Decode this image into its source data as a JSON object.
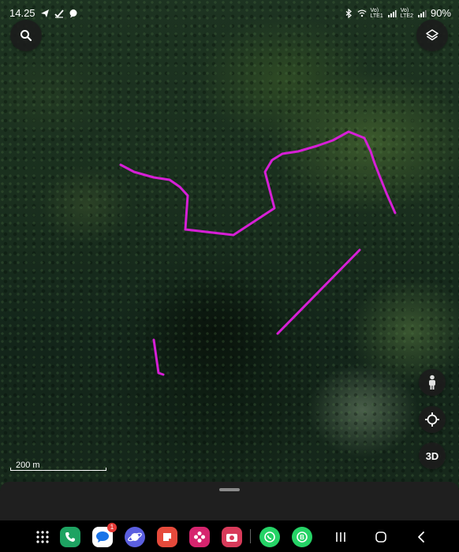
{
  "status": {
    "time": "14.25",
    "net1": "Vo)\nLTE1",
    "net2": "Vo)\nLTE2",
    "battery": "90%"
  },
  "controls": {
    "search_icon": "search-icon",
    "layers_icon": "layers-icon",
    "pegman_icon": "pegman-icon",
    "locate_icon": "locate-icon",
    "threed_label": "3D"
  },
  "scale": {
    "label": "200 m"
  },
  "routes_color": "#d61fd6",
  "taskbar": {
    "apps": [
      {
        "name": "phone",
        "color": "#1ea362"
      },
      {
        "name": "messages",
        "color": "#ffffff",
        "badge": "1"
      },
      {
        "name": "internet",
        "color": "#5b5fe0"
      },
      {
        "name": "notes",
        "color": "#e64a3b"
      },
      {
        "name": "gallery",
        "color": "#d6246e"
      },
      {
        "name": "camera",
        "color": "#d83a5a"
      },
      {
        "name": "whatsapp",
        "color": "#25d366"
      },
      {
        "name": "whatsapp-business",
        "color": "#25d366"
      }
    ]
  }
}
